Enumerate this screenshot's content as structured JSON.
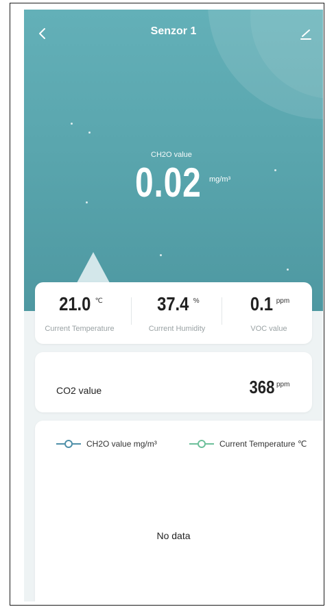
{
  "header": {
    "title": "Senzor 1",
    "back_icon": "chevron-left-icon",
    "edit_icon": "pencil-icon"
  },
  "hero": {
    "label": "CH2O value",
    "value": "0.02",
    "unit": "mg/m³"
  },
  "metrics": [
    {
      "value": "21.0",
      "unit": "℃",
      "label": "Current Temperature"
    },
    {
      "value": "37.4",
      "unit": "%",
      "label": "Current Humidity"
    },
    {
      "value": "0.1",
      "unit": "ppm",
      "label": "VOC value"
    }
  ],
  "co2": {
    "label": "CO2 value",
    "value": "368",
    "unit": "ppm"
  },
  "chart": {
    "legend": [
      {
        "label": "CH2O value mg/m³",
        "color": "#4e8fa8"
      },
      {
        "label": "Current Temperature ℃",
        "color": "#6cbf9a"
      }
    ],
    "empty_text": "No data"
  },
  "colors": {
    "hero": "#5aa6ae",
    "text": "#222222",
    "muted": "#9aa2a4"
  }
}
